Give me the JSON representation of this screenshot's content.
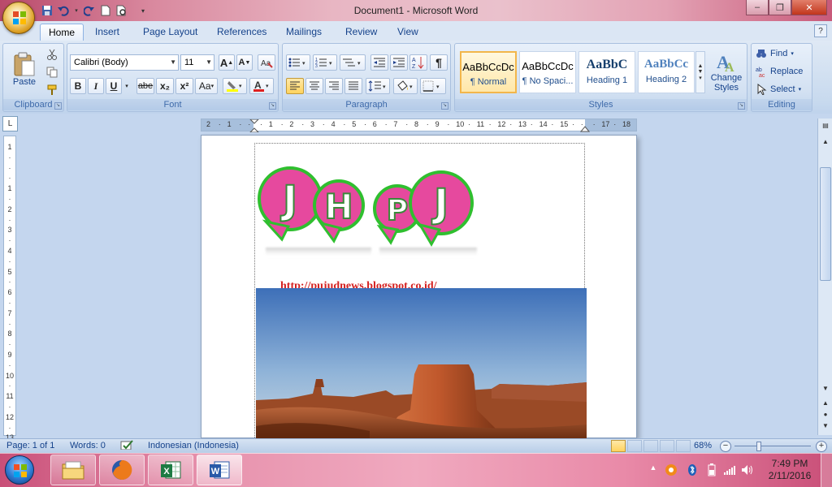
{
  "window": {
    "title": "Document1 - Microsoft Word",
    "controls": {
      "minimize": "–",
      "maximize": "❐",
      "close": "✕"
    }
  },
  "quick_access": [
    "save-icon",
    "undo-icon",
    "redo-icon",
    "new-icon",
    "print-preview-icon",
    "customize-icon"
  ],
  "tabs": [
    "Home",
    "Insert",
    "Page Layout",
    "References",
    "Mailings",
    "Review",
    "View"
  ],
  "ribbon": {
    "clipboard": {
      "label": "Clipboard",
      "paste": "Paste"
    },
    "font": {
      "label": "Font",
      "name": "Calibri (Body)",
      "size": "11",
      "grow": "A",
      "shrink": "A",
      "bold": "B",
      "italic": "I",
      "underline": "U",
      "strike": "abe",
      "subscript": "x₂",
      "superscript": "x²",
      "case": "Aa",
      "color": "A"
    },
    "paragraph": {
      "label": "Paragraph",
      "pilcrow": "¶"
    },
    "styles": {
      "label": "Styles",
      "items": [
        {
          "sample": "AaBbCcDc",
          "name": "¶ Normal"
        },
        {
          "sample": "AaBbCcDc",
          "name": "¶ No Spaci..."
        },
        {
          "sample": "AaBbC",
          "name": "Heading 1"
        },
        {
          "sample": "AaBbCc",
          "name": "Heading 2"
        }
      ],
      "change_styles": "Change Styles"
    },
    "editing": {
      "label": "Editing",
      "find": "Find",
      "replace": "Replace",
      "select": "Select"
    }
  },
  "rulers": {
    "horizontal": [
      "2",
      "1",
      "",
      "1",
      "2",
      "3",
      "4",
      "5",
      "6",
      "7",
      "8",
      "9",
      "10",
      "11",
      "12",
      "13",
      "14",
      "15",
      "",
      "17",
      "18"
    ],
    "vertical": [
      "1",
      "",
      "1",
      "2",
      "3",
      "4",
      "5",
      "6",
      "7",
      "8",
      "9",
      "10",
      "11",
      "12",
      "13"
    ]
  },
  "document": {
    "logo_letters": [
      "J",
      "H",
      "P",
      "J"
    ],
    "link": "http://pujudnews.blogspot.co.id/"
  },
  "statusbar": {
    "page": "Page: 1 of 1",
    "words": "Words: 0",
    "language": "Indonesian (Indonesia)",
    "zoom": "68%",
    "zoom_level": 0.68
  },
  "taskbar": {
    "apps": [
      "file-explorer-icon",
      "firefox-icon",
      "excel-icon",
      "word-icon"
    ],
    "time": "7:49 PM",
    "date": "2/11/2016"
  },
  "colors": {
    "ribbon": "#dbe6f4",
    "doc_bg": "#c4d6ee",
    "link": "#d42020",
    "logo_pink": "#e6499e",
    "logo_green": "#2fbf2f"
  }
}
